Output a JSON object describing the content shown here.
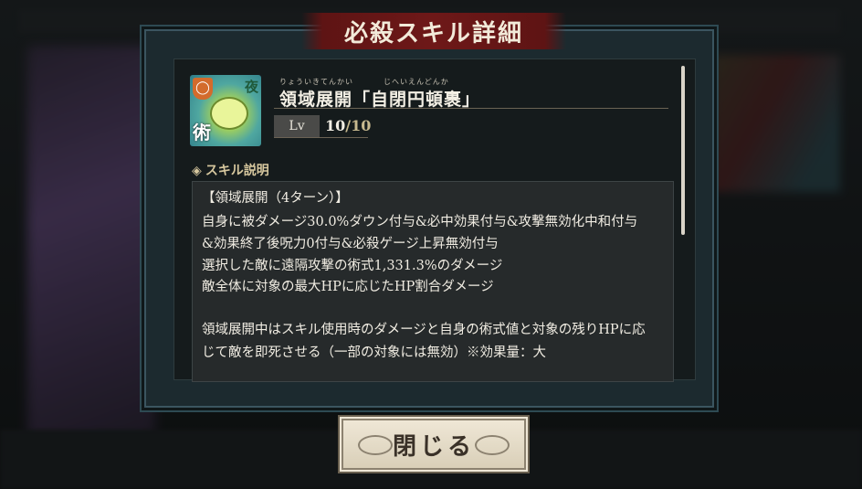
{
  "dialog": {
    "title": "必殺スキル詳細",
    "close_label": "閉じる"
  },
  "skill": {
    "icon": "skill-icon",
    "icon_badges": {
      "top_right": "夜",
      "bottom_left": "術"
    },
    "ruby": [
      "りょういきてんかい",
      "じへいえんどんか"
    ],
    "name": "領域展開「自閉円頓裹」",
    "level_label": "Lv",
    "level_current": "10",
    "level_sep": "/",
    "level_max": "10"
  },
  "description": {
    "section_label": "スキル説明",
    "lines": [
      "【領域展開（4ターン）】",
      "自身に被ダメージ30.0%ダウン付与&必中効果付与&攻撃無効化中和付与",
      "&効果終了後呪力0付与&必殺ゲージ上昇無効付与",
      "選択した敵に遠隔攻撃の術式1,331.3%のダメージ",
      "敵全体に対象の最大HPに応じたHP割合ダメージ",
      "",
      "領域展開中はスキル使用時のダメージと自身の術式値と対象の残りHPに応",
      "じて敵を即死させる（一部の対象には無効）※効果量：大"
    ]
  },
  "colors": {
    "banner": "#6e1818",
    "panel": "#151b1c",
    "frame": "#1c2a2f",
    "button": "#efe7d6"
  }
}
